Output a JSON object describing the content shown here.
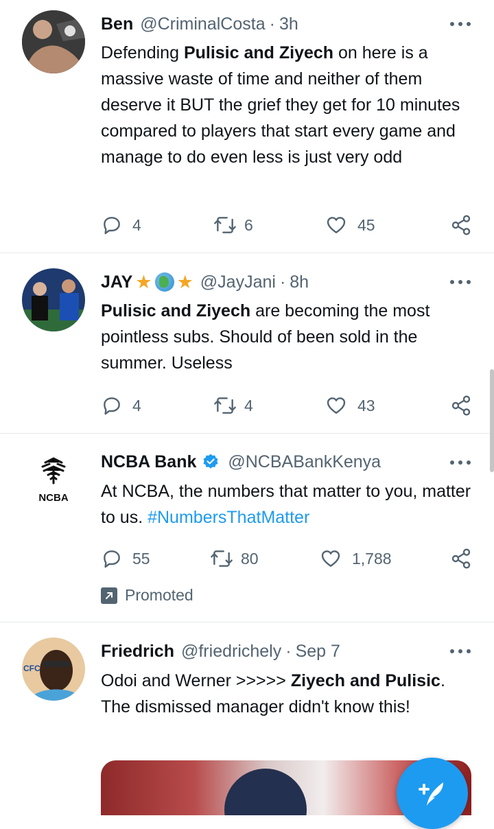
{
  "tweets": [
    {
      "name": "Ben",
      "handle": "@CriminalCosta",
      "time": "3h",
      "body_parts": [
        "Defending ",
        "Pulisic and Ziyech",
        " on here is a massive waste of time and neither of them deserve it BUT the grief they get for 10 minutes compared to players that start every game and manage to do even less is just very odd"
      ],
      "replies": "4",
      "retweets": "6",
      "likes": "45"
    },
    {
      "name": "JAY",
      "handle": "@JayJani",
      "time": "8h",
      "body_parts": [
        "Pulisic and Ziyech",
        " are becoming the most pointless subs. Should of been sold in the summer. Useless"
      ],
      "replies": "4",
      "retweets": "4",
      "likes": "43"
    },
    {
      "name": "NCBA Bank",
      "handle": "@NCBABankKenya",
      "avatar_text": "NCBA",
      "body_parts": [
        "At NCBA, the numbers that matter to you, matter to us. "
      ],
      "hashtag": "#NumbersThatMatter",
      "replies": "55",
      "retweets": "80",
      "likes": "1,788",
      "promoted": "Promoted"
    },
    {
      "name": "Friedrich",
      "handle": "@friedrichely",
      "time": "Sep 7",
      "avatar_badge": "CFC",
      "body_parts": [
        "Odoi and Werner >>>>> ",
        "Ziyech and Pulisic",
        ". The dismissed manager didn't know this!"
      ]
    }
  ],
  "separator": "·",
  "colors": {
    "accent": "#1d9bf0",
    "muted": "#536471",
    "text": "#0f1419",
    "star": "#f5a623",
    "verified": "#1d9bf0"
  },
  "icons": [
    "reply-icon",
    "retweet-icon",
    "like-icon",
    "share-icon",
    "more-icon",
    "promoted-icon",
    "verified-icon",
    "compose-icon"
  ]
}
